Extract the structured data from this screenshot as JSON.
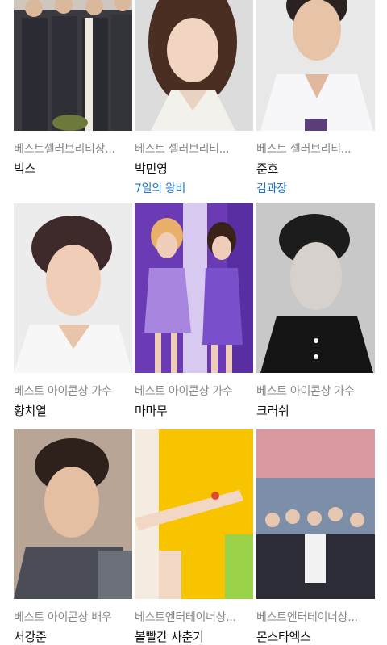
{
  "cards": [
    {
      "award": "베스트셀러브리티상...",
      "name": "빅스",
      "work": ""
    },
    {
      "award": "베스트 셀러브리티...",
      "name": "박민영",
      "work": "7일의 왕비"
    },
    {
      "award": "베스트 셀러브리티...",
      "name": "준호",
      "work": "김과장"
    },
    {
      "award": "베스트 아이콘상 가수",
      "name": "황치열",
      "work": ""
    },
    {
      "award": "베스트 아이콘상 가수",
      "name": "마마무",
      "work": ""
    },
    {
      "award": "베스트 아이콘상 가수",
      "name": "크러쉬",
      "work": ""
    },
    {
      "award": "베스트 아이콘상 배우",
      "name": "서강준",
      "work": ""
    },
    {
      "award": "베스트엔터테이너상...",
      "name": "볼빨간 사춘기",
      "work": ""
    },
    {
      "award": "베스트엔터테이너상...",
      "name": "몬스타엑스",
      "work": ""
    }
  ],
  "colors": {
    "award": "#8a8a8a",
    "name": "#111111",
    "link": "#1a73c9"
  }
}
